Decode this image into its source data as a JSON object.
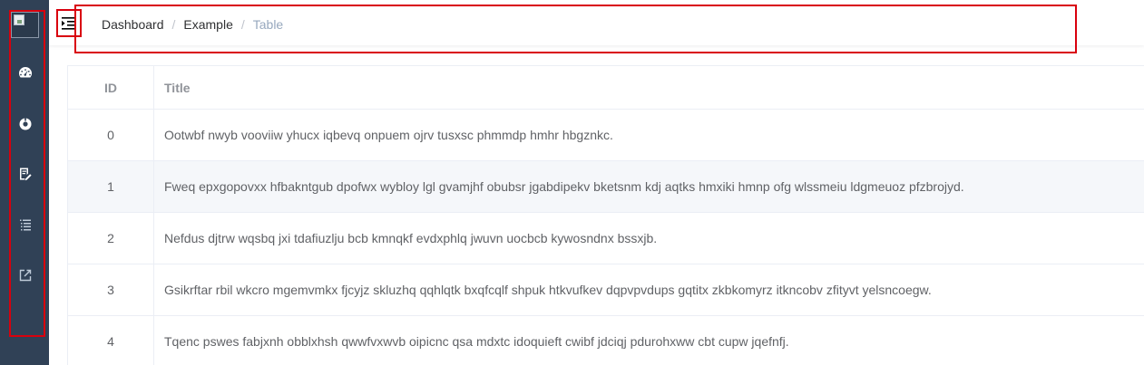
{
  "sidebar": {
    "icons": [
      "broken-image-icon",
      "dashboard-icon",
      "example-icon",
      "form-icon",
      "nested-list-icon",
      "external-link-icon"
    ]
  },
  "header": {
    "breadcrumb": {
      "items": [
        "Dashboard",
        "Example",
        "Table"
      ],
      "separator": "/"
    }
  },
  "table": {
    "columns": [
      "ID",
      "Title"
    ],
    "rows": [
      {
        "id": "0",
        "title": "Ootwbf nwyb vooviiw yhucx iqbevq onpuem ojrv tusxsc phmmdp hmhr hbgznkc."
      },
      {
        "id": "1",
        "title": "Fweq epxgopovxx hfbakntgub dpofwx wybloy lgl gvamjhf obubsr jgabdipekv bketsnm kdj aqtks hmxiki hmnp ofg wlssmeiu ldgmeuoz pfzbrojyd."
      },
      {
        "id": "2",
        "title": "Nefdus djtrw wqsbq jxi tdafiuzlju bcb kmnqkf evdxphlq jwuvn uocbcb kywosndnx bssxjb."
      },
      {
        "id": "3",
        "title": "Gsikrftar rbil wkcro mgemvmkx fjcyjz skluzhq qqhlqtk bxqfcqlf shpuk htkvufkev dqpvpvdups gqtitx zkbkomyrz itkncobv zfityvt yelsncoegw."
      },
      {
        "id": "4",
        "title": "Tqenc pswes fabjxnh obblxhsh qwwfvxwvb oipicnc qsa mdxtc idoquieft cwibf jdciqj pdurohxww cbt cupw jqefnfj."
      }
    ]
  },
  "colors": {
    "sidebar_bg": "#304156",
    "highlight_outline": "#d9000d",
    "row_stripe": "#f5f7fa"
  }
}
